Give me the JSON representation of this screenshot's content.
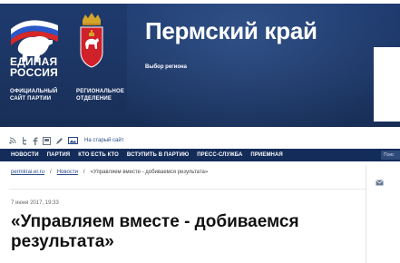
{
  "header": {
    "party_name_line1": "ЕДИНАЯ",
    "party_name_line2": "РОССИЯ",
    "party_sub_line1": "ОФИЦИАЛЬНЫЙ",
    "party_sub_line2": "САЙТ ПАРТИИ",
    "branch_sub_line1": "РЕГИОНАЛЬНОЕ",
    "branch_sub_line2": "ОТДЕЛЕНИЕ",
    "region_title": "Пермский край",
    "region_select": "Выбор региона"
  },
  "tools": {
    "icons": [
      "rss-icon",
      "twitter-icon",
      "facebook-icon",
      "print-icon",
      "edit-icon",
      "image-icon"
    ],
    "old_site": "На старый сайт"
  },
  "nav": {
    "items": [
      "НОВОСТИ",
      "ПАРТИЯ",
      "КТО ЕСТЬ КТО",
      "ВСТУПИТЬ В ПАРТИЮ",
      "ПРЕСС-СЛУЖБА",
      "ПРИЕМНАЯ"
    ],
    "search": "Поис"
  },
  "breadcrumb": {
    "home": "permkrai.er.ru",
    "sep": "/",
    "section": "Новости",
    "current": "«Управляем вместе - добиваемся результата»"
  },
  "article": {
    "date": "7 июня 2017, 19:33",
    "headline": "«Управляем вместе - добиваемся результата»"
  },
  "colors": {
    "header_bg": "#1c3563",
    "nav_bg": "#142c5a",
    "link": "#2a4a8a"
  }
}
